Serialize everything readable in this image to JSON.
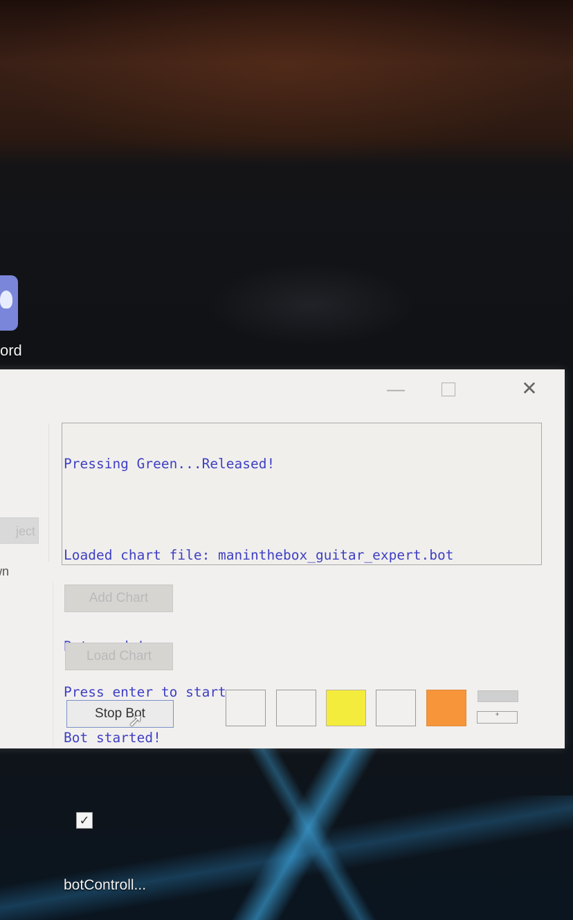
{
  "desktop": {
    "icons": [
      {
        "label": "ord"
      },
      {
        "label": "botControll..."
      }
    ],
    "shortcut_check": "✓"
  },
  "window": {
    "controls": {
      "minimize": "—",
      "close": "✕"
    },
    "left_panel": {
      "button_label": "ject",
      "label": "own"
    },
    "log_lines": [
      "Pressing Green...Released!",
      "",
      "Loaded chart file: maninthebox_guitar_expert.bot",
      "",
      "Bot ready!",
      "Press enter to start...",
      "Bot started!"
    ],
    "buttons": {
      "add_chart": "Add Chart",
      "load_chart": "Load Chart",
      "stop_bot": "Stop Bot"
    },
    "swatches": [
      {
        "color": "#f1f0ee"
      },
      {
        "color": "#f1f0ee"
      },
      {
        "color": "#f4ec3c"
      },
      {
        "color": "#f1f0ee"
      },
      {
        "color": "#f7953a"
      }
    ],
    "mini_indicator": "+"
  },
  "colors": {
    "log_text": "#3f3fc4",
    "window_bg": "#f1f0ee"
  }
}
